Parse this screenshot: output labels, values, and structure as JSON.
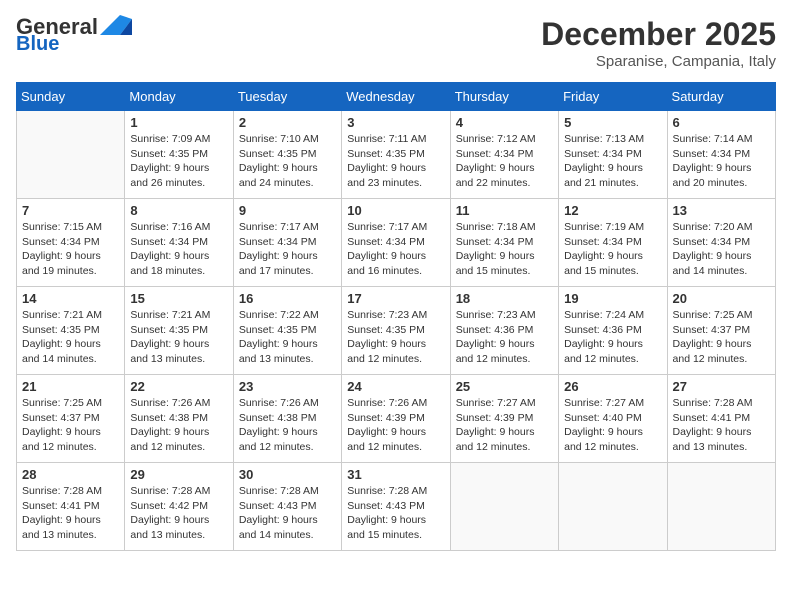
{
  "header": {
    "logo_line1": "General",
    "logo_line2": "Blue",
    "month": "December 2025",
    "location": "Sparanise, Campania, Italy"
  },
  "days_of_week": [
    "Sunday",
    "Monday",
    "Tuesday",
    "Wednesday",
    "Thursday",
    "Friday",
    "Saturday"
  ],
  "weeks": [
    [
      {
        "day": "",
        "info": ""
      },
      {
        "day": "1",
        "info": "Sunrise: 7:09 AM\nSunset: 4:35 PM\nDaylight: 9 hours\nand 26 minutes."
      },
      {
        "day": "2",
        "info": "Sunrise: 7:10 AM\nSunset: 4:35 PM\nDaylight: 9 hours\nand 24 minutes."
      },
      {
        "day": "3",
        "info": "Sunrise: 7:11 AM\nSunset: 4:35 PM\nDaylight: 9 hours\nand 23 minutes."
      },
      {
        "day": "4",
        "info": "Sunrise: 7:12 AM\nSunset: 4:34 PM\nDaylight: 9 hours\nand 22 minutes."
      },
      {
        "day": "5",
        "info": "Sunrise: 7:13 AM\nSunset: 4:34 PM\nDaylight: 9 hours\nand 21 minutes."
      },
      {
        "day": "6",
        "info": "Sunrise: 7:14 AM\nSunset: 4:34 PM\nDaylight: 9 hours\nand 20 minutes."
      }
    ],
    [
      {
        "day": "7",
        "info": "Sunrise: 7:15 AM\nSunset: 4:34 PM\nDaylight: 9 hours\nand 19 minutes."
      },
      {
        "day": "8",
        "info": "Sunrise: 7:16 AM\nSunset: 4:34 PM\nDaylight: 9 hours\nand 18 minutes."
      },
      {
        "day": "9",
        "info": "Sunrise: 7:17 AM\nSunset: 4:34 PM\nDaylight: 9 hours\nand 17 minutes."
      },
      {
        "day": "10",
        "info": "Sunrise: 7:17 AM\nSunset: 4:34 PM\nDaylight: 9 hours\nand 16 minutes."
      },
      {
        "day": "11",
        "info": "Sunrise: 7:18 AM\nSunset: 4:34 PM\nDaylight: 9 hours\nand 15 minutes."
      },
      {
        "day": "12",
        "info": "Sunrise: 7:19 AM\nSunset: 4:34 PM\nDaylight: 9 hours\nand 15 minutes."
      },
      {
        "day": "13",
        "info": "Sunrise: 7:20 AM\nSunset: 4:34 PM\nDaylight: 9 hours\nand 14 minutes."
      }
    ],
    [
      {
        "day": "14",
        "info": "Sunrise: 7:21 AM\nSunset: 4:35 PM\nDaylight: 9 hours\nand 14 minutes."
      },
      {
        "day": "15",
        "info": "Sunrise: 7:21 AM\nSunset: 4:35 PM\nDaylight: 9 hours\nand 13 minutes."
      },
      {
        "day": "16",
        "info": "Sunrise: 7:22 AM\nSunset: 4:35 PM\nDaylight: 9 hours\nand 13 minutes."
      },
      {
        "day": "17",
        "info": "Sunrise: 7:23 AM\nSunset: 4:35 PM\nDaylight: 9 hours\nand 12 minutes."
      },
      {
        "day": "18",
        "info": "Sunrise: 7:23 AM\nSunset: 4:36 PM\nDaylight: 9 hours\nand 12 minutes."
      },
      {
        "day": "19",
        "info": "Sunrise: 7:24 AM\nSunset: 4:36 PM\nDaylight: 9 hours\nand 12 minutes."
      },
      {
        "day": "20",
        "info": "Sunrise: 7:25 AM\nSunset: 4:37 PM\nDaylight: 9 hours\nand 12 minutes."
      }
    ],
    [
      {
        "day": "21",
        "info": "Sunrise: 7:25 AM\nSunset: 4:37 PM\nDaylight: 9 hours\nand 12 minutes."
      },
      {
        "day": "22",
        "info": "Sunrise: 7:26 AM\nSunset: 4:38 PM\nDaylight: 9 hours\nand 12 minutes."
      },
      {
        "day": "23",
        "info": "Sunrise: 7:26 AM\nSunset: 4:38 PM\nDaylight: 9 hours\nand 12 minutes."
      },
      {
        "day": "24",
        "info": "Sunrise: 7:26 AM\nSunset: 4:39 PM\nDaylight: 9 hours\nand 12 minutes."
      },
      {
        "day": "25",
        "info": "Sunrise: 7:27 AM\nSunset: 4:39 PM\nDaylight: 9 hours\nand 12 minutes."
      },
      {
        "day": "26",
        "info": "Sunrise: 7:27 AM\nSunset: 4:40 PM\nDaylight: 9 hours\nand 12 minutes."
      },
      {
        "day": "27",
        "info": "Sunrise: 7:28 AM\nSunset: 4:41 PM\nDaylight: 9 hours\nand 13 minutes."
      }
    ],
    [
      {
        "day": "28",
        "info": "Sunrise: 7:28 AM\nSunset: 4:41 PM\nDaylight: 9 hours\nand 13 minutes."
      },
      {
        "day": "29",
        "info": "Sunrise: 7:28 AM\nSunset: 4:42 PM\nDaylight: 9 hours\nand 13 minutes."
      },
      {
        "day": "30",
        "info": "Sunrise: 7:28 AM\nSunset: 4:43 PM\nDaylight: 9 hours\nand 14 minutes."
      },
      {
        "day": "31",
        "info": "Sunrise: 7:28 AM\nSunset: 4:43 PM\nDaylight: 9 hours\nand 15 minutes."
      },
      {
        "day": "",
        "info": ""
      },
      {
        "day": "",
        "info": ""
      },
      {
        "day": "",
        "info": ""
      }
    ]
  ]
}
